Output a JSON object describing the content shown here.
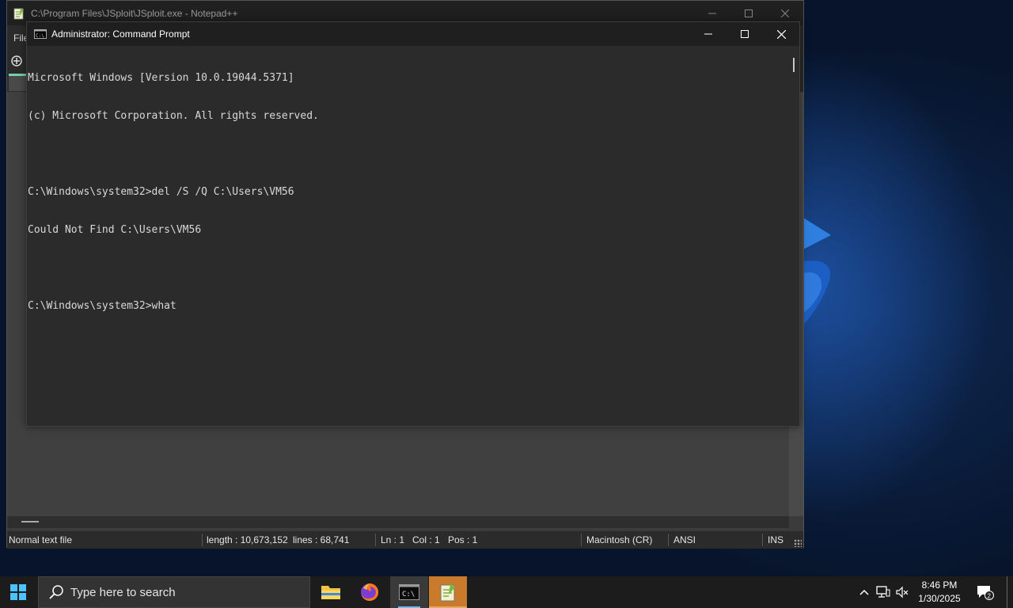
{
  "notepadpp": {
    "title": "C:\\Program Files\\JSploit\\JSploit.exe - Notepad++",
    "menu_file": "File",
    "status": {
      "file_type": "Normal text file",
      "length": "length : 10,673,152",
      "lines": "lines : 68,741",
      "ln": "Ln : 1",
      "col": "Col : 1",
      "pos": "Pos : 1",
      "eol": "Macintosh (CR)",
      "encoding": "ANSI",
      "mode": "INS"
    }
  },
  "cmd": {
    "title": "Administrator: Command Prompt",
    "icon_text": "C:\\",
    "lines": [
      "Microsoft Windows [Version 10.0.19044.5371]",
      "(c) Microsoft Corporation. All rights reserved.",
      "",
      "C:\\Windows\\system32>del /S /Q C:\\Users\\VM56",
      "Could Not Find C:\\Users\\VM56",
      "",
      "C:\\Windows\\system32>what"
    ]
  },
  "taskbar": {
    "search_placeholder": "Type here to search",
    "apps": [
      "file-explorer",
      "firefox",
      "command-prompt",
      "notepad-plus-plus"
    ],
    "cmd_icon_text": "C:\\",
    "time": "8:46 PM",
    "date": "1/30/2025",
    "notification_count": "2"
  },
  "colors": {
    "accent": "#76b9ed",
    "npp_taskbar": "#c97a2a",
    "terminal_bg": "#2b2b2b",
    "terminal_fg": "#d8d8d8"
  }
}
